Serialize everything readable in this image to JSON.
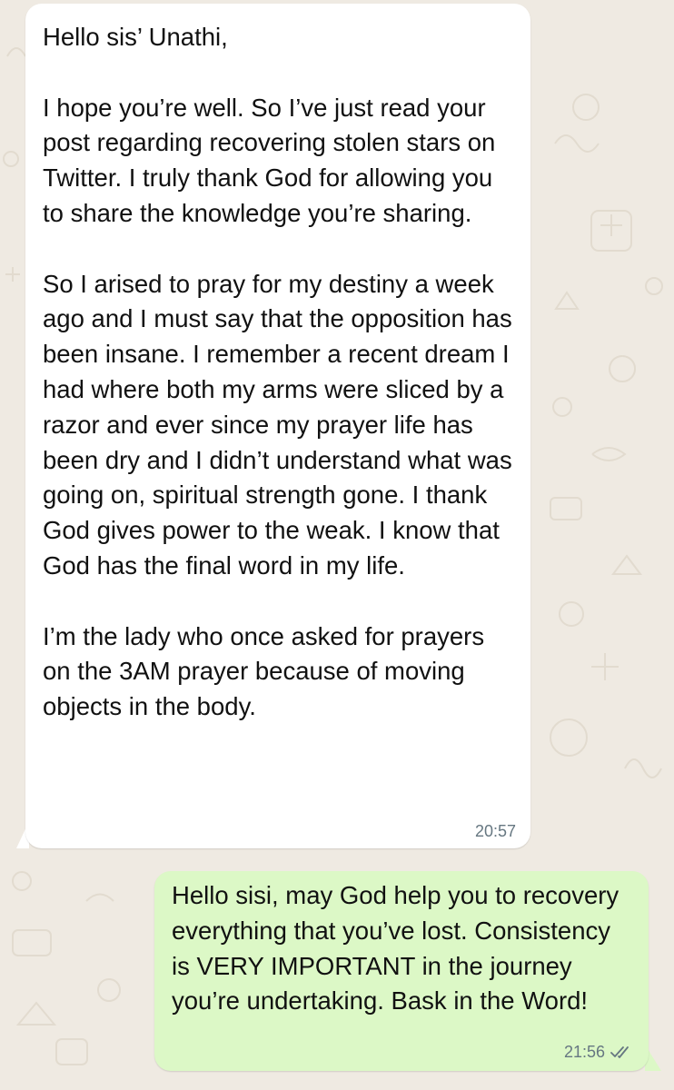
{
  "conversation": {
    "messages": [
      {
        "direction": "incoming",
        "paragraphs": [
          "Hello sis’ Unathi,",
          "I hope you’re well. So I’ve just read your post regarding recovering stolen stars on Twitter. I truly thank God for allowing you to share the knowledge you’re sharing.",
          "So I arised to pray for my destiny a week ago and I must say that the opposition has been insane. I remember a recent dream I had where both my arms were sliced by a razor and ever since my prayer life has been dry and I didn’t understand what was going on, spiritual strength gone. I thank God gives power to the weak. I know that God has the final word in my life.",
          "I’m the lady who once asked for prayers on the 3AM prayer because of moving objects in the body."
        ],
        "time": "20:57"
      },
      {
        "direction": "outgoing",
        "paragraphs": [
          "Hello sisi, may God help you to recovery everything that you’ve lost. Consistency is VERY IMPORTANT in the journey you’re undertaking. Bask in the Word!"
        ],
        "time": "21:56",
        "status_icon": "double-check-icon"
      }
    ]
  },
  "colors": {
    "wallpaper": "#efeae2",
    "wallpaper_doodle": "#e3ddd2",
    "incoming_bubble": "#ffffff",
    "outgoing_bubble": "#dcf8c6",
    "message_text": "#111111",
    "meta_text": "#667781"
  }
}
